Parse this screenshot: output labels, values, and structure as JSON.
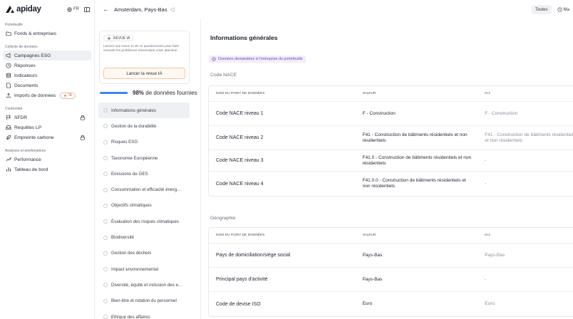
{
  "brand": {
    "name": "apiday",
    "language": "FR"
  },
  "sidebar": {
    "sections": [
      {
        "label": "Portefeuille",
        "items": [
          {
            "label": "Fonds & entreprises",
            "icon": "folder-icon"
          }
        ]
      },
      {
        "label": "Collecte de données",
        "items": [
          {
            "label": "Campagnes ESG",
            "icon": "megaphone-icon",
            "active": true
          },
          {
            "label": "Réponses",
            "icon": "clock-icon"
          },
          {
            "label": "Indicateurs",
            "icon": "database-icon"
          },
          {
            "label": "Documents",
            "icon": "document-icon"
          },
          {
            "label": "Imports de données",
            "icon": "upload-icon",
            "badge": "IA"
          }
        ]
      },
      {
        "label": "Conformité",
        "items": [
          {
            "label": "SFDR",
            "icon": "flag-icon",
            "locked": true
          },
          {
            "label": "Requêtes LP",
            "icon": "inbox-icon"
          },
          {
            "label": "Empreinte carbone",
            "icon": "leaf-icon",
            "locked": true
          }
        ]
      },
      {
        "label": "Analyses et améliorations",
        "items": [
          {
            "label": "Performance",
            "icon": "trend-icon"
          },
          {
            "label": "Tableau de bord",
            "icon": "bar-chart-icon"
          }
        ]
      }
    ]
  },
  "topbar": {
    "title": "Amsterdam, Pays-Bas",
    "filters": [
      {
        "label": "Toutes",
        "active": true
      },
      {
        "label": "Ma"
      }
    ]
  },
  "ai_review": {
    "tag": "REVUE IA",
    "description": "Lancez une revue IA de ce questionnaire pour faire ressortir les problèmes nécessitant votre attention",
    "button": "Lancer la revue IA"
  },
  "progress": {
    "percent_label": "98%",
    "suffix": " de données fournies",
    "fraction": 0.98
  },
  "sections": [
    "Informations générales",
    "Gestion de la durabilité",
    "Risques ESG",
    "Taxonomie Européenne",
    "Émissions de GES",
    "Consommation et efficacité énerg...",
    "Objectifs climatiques",
    "Évaluation des risques climatiques",
    "Biodiversité",
    "Gestion des déchets",
    "Impact environnemental",
    "Diversité, équité et inclusion des e...",
    "Bien-être et rotation du personnel",
    "Éthique des affaires"
  ],
  "main": {
    "title": "Informations générales",
    "requested_badge": "Données demandées à l'entreprise du portefeuille",
    "columns": [
      "Nom du point de données",
      "Valeur",
      "N-1"
    ],
    "groups": [
      {
        "title": "Code NACE",
        "rows": [
          [
            "Code NACE niveau 1",
            "F - Construction",
            "F - Construction"
          ],
          [
            "Code NACE niveau 2",
            "F41 - Construction de bâtiments résidentiels et non résidentiels",
            "F41 - Construction de bâtiments résidentiels et non résidentiels"
          ],
          [
            "Code NACE niveau 3",
            "F41.0 - Construction de bâtiments résidentiels et non résidentiels",
            "-"
          ],
          [
            "Code NACE niveau 4",
            "F41.0.0 - Construction de bâtiments résidentiels et non résidentiels",
            "-"
          ]
        ]
      },
      {
        "title": "Géographie",
        "rows": [
          [
            "Pays de domiciliation/siège social",
            "Pays-Bas",
            "Pays-Bas"
          ],
          [
            "Principal pays d'activité",
            "Pays-Bas",
            "-"
          ],
          [
            "Code de devise ISO",
            "Euro",
            "Euro"
          ]
        ]
      }
    ]
  },
  "colors": {
    "accent": "#3f84e8",
    "ai_orange": "#c06a3e",
    "active_bg": "#eef0f4",
    "badge_purple": "#6a4bb4"
  }
}
